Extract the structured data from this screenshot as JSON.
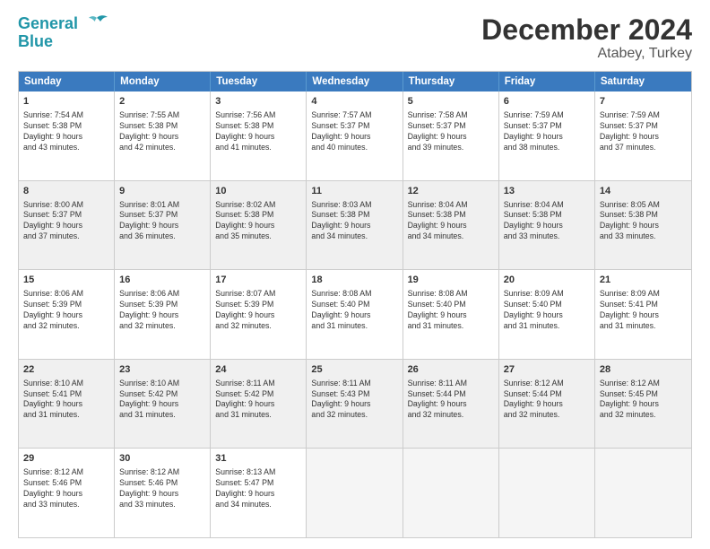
{
  "logo": {
    "line1": "General",
    "line2": "Blue"
  },
  "title": "December 2024",
  "subtitle": "Atabey, Turkey",
  "days_of_week": [
    "Sunday",
    "Monday",
    "Tuesday",
    "Wednesday",
    "Thursday",
    "Friday",
    "Saturday"
  ],
  "weeks": [
    [
      {
        "day": "1",
        "lines": [
          "Sunrise: 7:54 AM",
          "Sunset: 5:38 PM",
          "Daylight: 9 hours",
          "and 43 minutes."
        ],
        "shaded": false
      },
      {
        "day": "2",
        "lines": [
          "Sunrise: 7:55 AM",
          "Sunset: 5:38 PM",
          "Daylight: 9 hours",
          "and 42 minutes."
        ],
        "shaded": false
      },
      {
        "day": "3",
        "lines": [
          "Sunrise: 7:56 AM",
          "Sunset: 5:38 PM",
          "Daylight: 9 hours",
          "and 41 minutes."
        ],
        "shaded": false
      },
      {
        "day": "4",
        "lines": [
          "Sunrise: 7:57 AM",
          "Sunset: 5:37 PM",
          "Daylight: 9 hours",
          "and 40 minutes."
        ],
        "shaded": false
      },
      {
        "day": "5",
        "lines": [
          "Sunrise: 7:58 AM",
          "Sunset: 5:37 PM",
          "Daylight: 9 hours",
          "and 39 minutes."
        ],
        "shaded": false
      },
      {
        "day": "6",
        "lines": [
          "Sunrise: 7:59 AM",
          "Sunset: 5:37 PM",
          "Daylight: 9 hours",
          "and 38 minutes."
        ],
        "shaded": false
      },
      {
        "day": "7",
        "lines": [
          "Sunrise: 7:59 AM",
          "Sunset: 5:37 PM",
          "Daylight: 9 hours",
          "and 37 minutes."
        ],
        "shaded": false
      }
    ],
    [
      {
        "day": "8",
        "lines": [
          "Sunrise: 8:00 AM",
          "Sunset: 5:37 PM",
          "Daylight: 9 hours",
          "and 37 minutes."
        ],
        "shaded": true
      },
      {
        "day": "9",
        "lines": [
          "Sunrise: 8:01 AM",
          "Sunset: 5:37 PM",
          "Daylight: 9 hours",
          "and 36 minutes."
        ],
        "shaded": true
      },
      {
        "day": "10",
        "lines": [
          "Sunrise: 8:02 AM",
          "Sunset: 5:38 PM",
          "Daylight: 9 hours",
          "and 35 minutes."
        ],
        "shaded": true
      },
      {
        "day": "11",
        "lines": [
          "Sunrise: 8:03 AM",
          "Sunset: 5:38 PM",
          "Daylight: 9 hours",
          "and 34 minutes."
        ],
        "shaded": true
      },
      {
        "day": "12",
        "lines": [
          "Sunrise: 8:04 AM",
          "Sunset: 5:38 PM",
          "Daylight: 9 hours",
          "and 34 minutes."
        ],
        "shaded": true
      },
      {
        "day": "13",
        "lines": [
          "Sunrise: 8:04 AM",
          "Sunset: 5:38 PM",
          "Daylight: 9 hours",
          "and 33 minutes."
        ],
        "shaded": true
      },
      {
        "day": "14",
        "lines": [
          "Sunrise: 8:05 AM",
          "Sunset: 5:38 PM",
          "Daylight: 9 hours",
          "and 33 minutes."
        ],
        "shaded": true
      }
    ],
    [
      {
        "day": "15",
        "lines": [
          "Sunrise: 8:06 AM",
          "Sunset: 5:39 PM",
          "Daylight: 9 hours",
          "and 32 minutes."
        ],
        "shaded": false
      },
      {
        "day": "16",
        "lines": [
          "Sunrise: 8:06 AM",
          "Sunset: 5:39 PM",
          "Daylight: 9 hours",
          "and 32 minutes."
        ],
        "shaded": false
      },
      {
        "day": "17",
        "lines": [
          "Sunrise: 8:07 AM",
          "Sunset: 5:39 PM",
          "Daylight: 9 hours",
          "and 32 minutes."
        ],
        "shaded": false
      },
      {
        "day": "18",
        "lines": [
          "Sunrise: 8:08 AM",
          "Sunset: 5:40 PM",
          "Daylight: 9 hours",
          "and 31 minutes."
        ],
        "shaded": false
      },
      {
        "day": "19",
        "lines": [
          "Sunrise: 8:08 AM",
          "Sunset: 5:40 PM",
          "Daylight: 9 hours",
          "and 31 minutes."
        ],
        "shaded": false
      },
      {
        "day": "20",
        "lines": [
          "Sunrise: 8:09 AM",
          "Sunset: 5:40 PM",
          "Daylight: 9 hours",
          "and 31 minutes."
        ],
        "shaded": false
      },
      {
        "day": "21",
        "lines": [
          "Sunrise: 8:09 AM",
          "Sunset: 5:41 PM",
          "Daylight: 9 hours",
          "and 31 minutes."
        ],
        "shaded": false
      }
    ],
    [
      {
        "day": "22",
        "lines": [
          "Sunrise: 8:10 AM",
          "Sunset: 5:41 PM",
          "Daylight: 9 hours",
          "and 31 minutes."
        ],
        "shaded": true
      },
      {
        "day": "23",
        "lines": [
          "Sunrise: 8:10 AM",
          "Sunset: 5:42 PM",
          "Daylight: 9 hours",
          "and 31 minutes."
        ],
        "shaded": true
      },
      {
        "day": "24",
        "lines": [
          "Sunrise: 8:11 AM",
          "Sunset: 5:42 PM",
          "Daylight: 9 hours",
          "and 31 minutes."
        ],
        "shaded": true
      },
      {
        "day": "25",
        "lines": [
          "Sunrise: 8:11 AM",
          "Sunset: 5:43 PM",
          "Daylight: 9 hours",
          "and 32 minutes."
        ],
        "shaded": true
      },
      {
        "day": "26",
        "lines": [
          "Sunrise: 8:11 AM",
          "Sunset: 5:44 PM",
          "Daylight: 9 hours",
          "and 32 minutes."
        ],
        "shaded": true
      },
      {
        "day": "27",
        "lines": [
          "Sunrise: 8:12 AM",
          "Sunset: 5:44 PM",
          "Daylight: 9 hours",
          "and 32 minutes."
        ],
        "shaded": true
      },
      {
        "day": "28",
        "lines": [
          "Sunrise: 8:12 AM",
          "Sunset: 5:45 PM",
          "Daylight: 9 hours",
          "and 32 minutes."
        ],
        "shaded": true
      }
    ],
    [
      {
        "day": "29",
        "lines": [
          "Sunrise: 8:12 AM",
          "Sunset: 5:46 PM",
          "Daylight: 9 hours",
          "and 33 minutes."
        ],
        "shaded": false
      },
      {
        "day": "30",
        "lines": [
          "Sunrise: 8:12 AM",
          "Sunset: 5:46 PM",
          "Daylight: 9 hours",
          "and 33 minutes."
        ],
        "shaded": false
      },
      {
        "day": "31",
        "lines": [
          "Sunrise: 8:13 AM",
          "Sunset: 5:47 PM",
          "Daylight: 9 hours",
          "and 34 minutes."
        ],
        "shaded": false
      },
      {
        "day": "",
        "lines": [],
        "shaded": false,
        "empty": true
      },
      {
        "day": "",
        "lines": [],
        "shaded": false,
        "empty": true
      },
      {
        "day": "",
        "lines": [],
        "shaded": false,
        "empty": true
      },
      {
        "day": "",
        "lines": [],
        "shaded": false,
        "empty": true
      }
    ]
  ]
}
